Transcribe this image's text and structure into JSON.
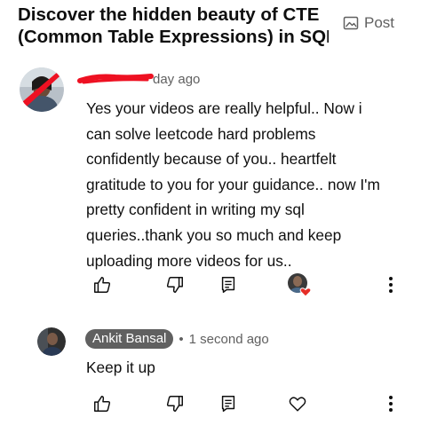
{
  "header": {
    "video_title_lines": [
      "Discover the hidden beauty of CTE",
      "(Common Table Expressions) in SQL..."
    ],
    "post_label": "Post"
  },
  "comment": {
    "author_name": "",
    "time_ago": "day ago",
    "text_lines": [
      "Yes your videos are really helpful.. Now i",
      "can solve leetcode hard problems",
      "confidently because of you.. heartfelt",
      "gratitude to you for your guidance.. now I'm",
      "pretty confident in writing my sql",
      "queries..thank you so much and keep",
      "uploading more videos for us.."
    ],
    "creator_hearted": true
  },
  "reply": {
    "author_name": "Ankit Bansal",
    "separator": "•",
    "time_ago": "1 second ago",
    "text": "Keep it up"
  },
  "icons": {
    "like": "thumbs-up-icon",
    "dislike": "thumbs-down-icon",
    "reply": "reply-icon",
    "more": "more-vert-icon",
    "heart": "heart-icon",
    "post": "image-post-icon"
  },
  "colors": {
    "text": "#0f0f0f",
    "muted": "#606060",
    "heart": "#e52d27",
    "redaction": "#ee1122",
    "chip": "#606060"
  }
}
